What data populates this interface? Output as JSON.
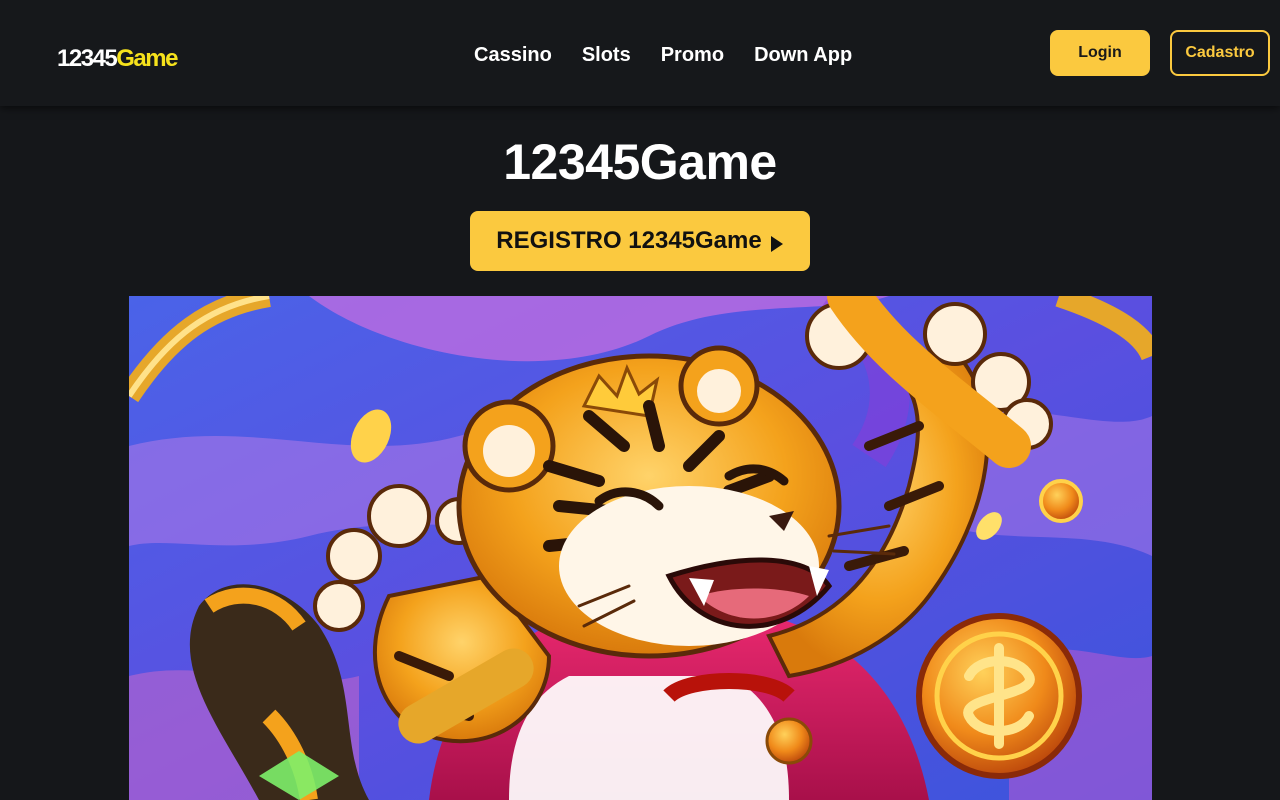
{
  "header": {
    "logo": {
      "number": "12345",
      "word": "Game"
    },
    "nav": [
      "Cassino",
      "Slots",
      "Promo",
      "Down App"
    ],
    "login_label": "Login",
    "register_label": "Cadastro"
  },
  "hero": {
    "title": "12345Game",
    "cta_label": "REGISTRO 12345Game",
    "cta_icon": "play-triangle-icon",
    "banner_image": "cartoon tiger mascot with gold coins"
  },
  "colors": {
    "background": "#15171a",
    "header": "#16181b",
    "accent": "#fbc93f",
    "logo_game": "#f6e21c"
  }
}
